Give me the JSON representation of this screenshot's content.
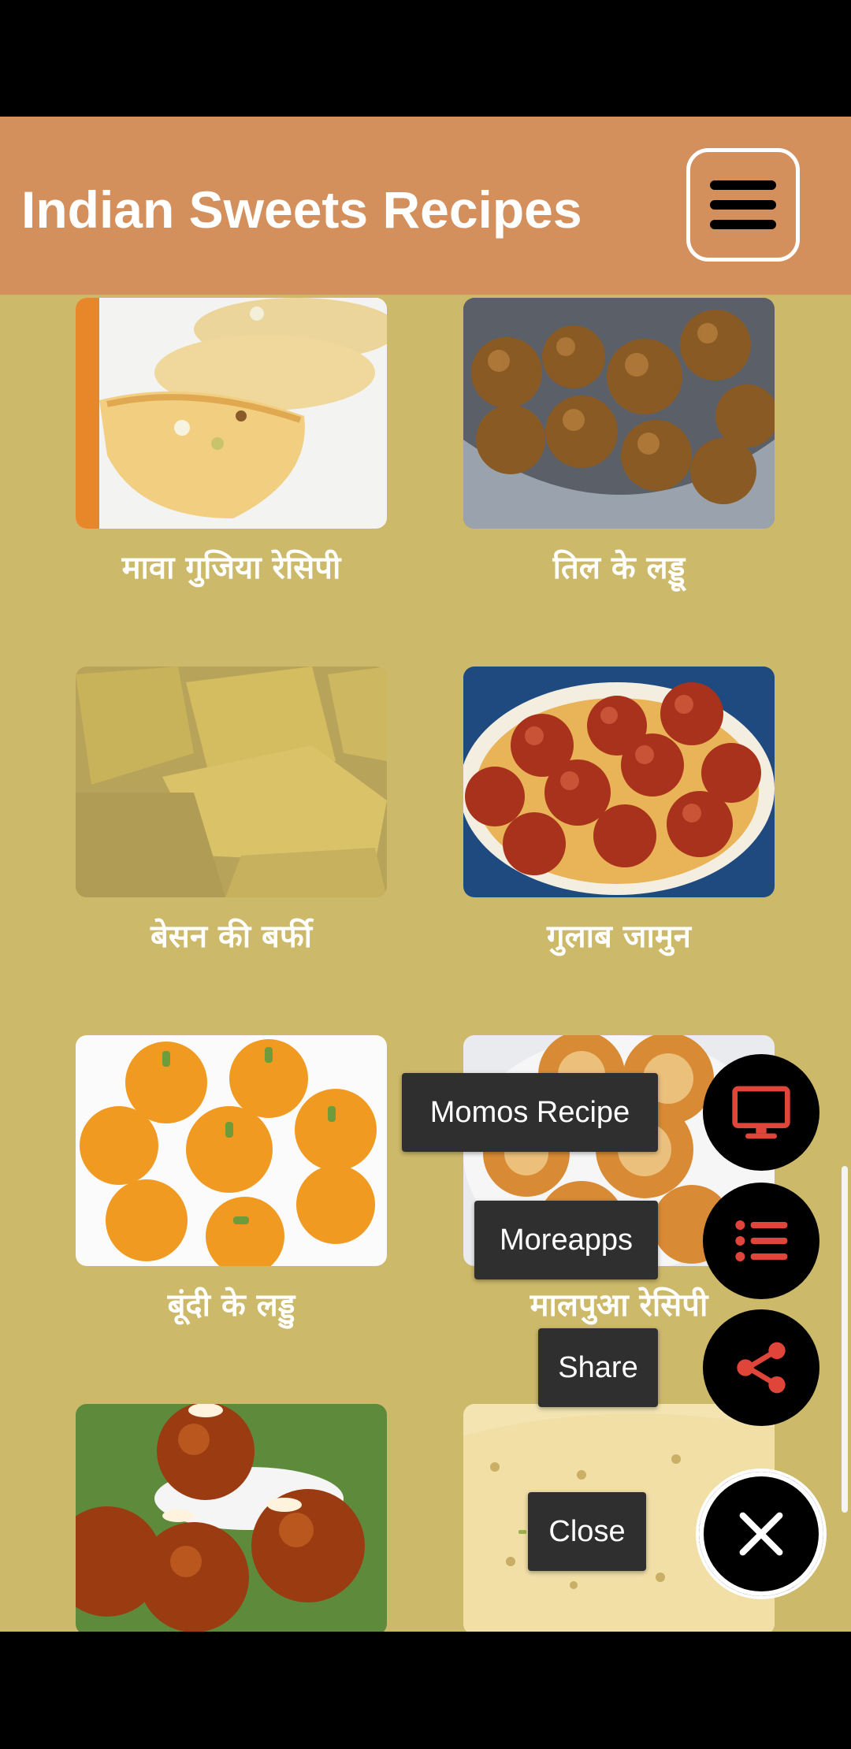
{
  "app": {
    "title": "Indian Sweets Recipes"
  },
  "recipes": [
    {
      "title": "मावा गुजिया रेसिपी"
    },
    {
      "title": "तिल के लड्डू"
    },
    {
      "title": "बेसन की बर्फी"
    },
    {
      "title": "गुलाब जामुन"
    },
    {
      "title": "बूंदी के लड्डु"
    },
    {
      "title": "मालपुआ रेसिपी"
    },
    {
      "title": ""
    },
    {
      "title": ""
    }
  ],
  "fab_menu": {
    "momos_label": "Momos Recipe",
    "moreapps_label": "Moreapps",
    "share_label": "Share",
    "close_label": "Close"
  },
  "colors": {
    "appbar": "#d4905c",
    "background": "#cdb96a",
    "fab_icon": "#e0453a"
  }
}
